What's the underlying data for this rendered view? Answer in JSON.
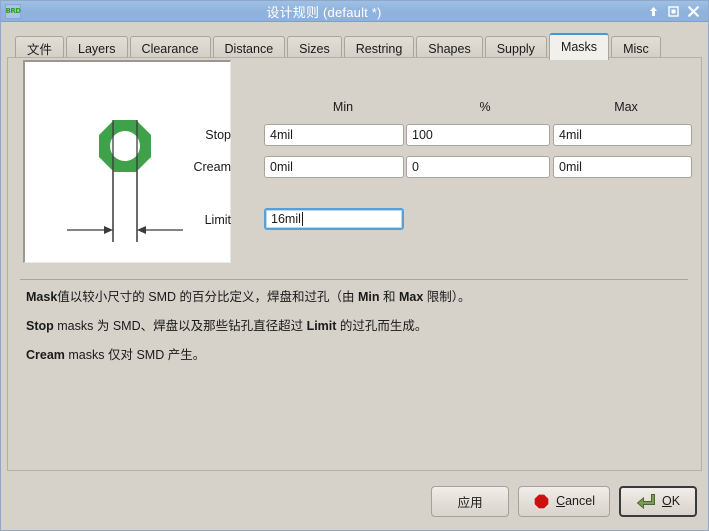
{
  "window": {
    "app_icon_label": "BRD",
    "title": "设计规则 (default *)",
    "controls": {
      "shade_label": "Shade",
      "maximize_label": "Maximize",
      "close_label": "Close"
    }
  },
  "tabs": [
    {
      "label": "文件",
      "active": false
    },
    {
      "label": "Layers",
      "active": false
    },
    {
      "label": "Clearance",
      "active": false
    },
    {
      "label": "Distance",
      "active": false
    },
    {
      "label": "Sizes",
      "active": false
    },
    {
      "label": "Restring",
      "active": false
    },
    {
      "label": "Shapes",
      "active": false
    },
    {
      "label": "Supply",
      "active": false
    },
    {
      "label": "Masks",
      "active": true
    },
    {
      "label": "Misc",
      "active": false
    }
  ],
  "masks": {
    "preview": {
      "pad_color": "#3ea24b",
      "hole_color": "#ffffff",
      "line_color": "#3b3b3b",
      "background": "#ffffff"
    },
    "columns": [
      "Min",
      "%",
      "Max"
    ],
    "rows": [
      {
        "label": "Stop",
        "min": "4mil",
        "percent": "100",
        "max": "4mil"
      },
      {
        "label": "Cream",
        "min": "0mil",
        "percent": "0",
        "max": "0mil"
      }
    ],
    "limit": {
      "label": "Limit",
      "value": "16mil",
      "focused": true
    },
    "description": [
      {
        "segments": [
          {
            "text": "Mask",
            "bold": true
          },
          {
            "text": "值以较小尺寸的 SMD 的百分比定义，焊盘和过孔（由 ",
            "bold": false
          },
          {
            "text": "Min",
            "bold": true
          },
          {
            "text": " 和 ",
            "bold": false
          },
          {
            "text": "Max",
            "bold": true
          },
          {
            "text": " 限制）。",
            "bold": false
          }
        ]
      },
      {
        "segments": [
          {
            "text": "Stop",
            "bold": true
          },
          {
            "text": " masks 为 SMD、焊盘以及那些钻孔直径超过 ",
            "bold": false
          },
          {
            "text": "Limit",
            "bold": true
          },
          {
            "text": " 的过孔而生成。",
            "bold": false
          }
        ]
      },
      {
        "segments": [
          {
            "text": "Cream",
            "bold": true
          },
          {
            "text": " masks 仅对 SMD 产生。",
            "bold": false
          }
        ]
      }
    ]
  },
  "footer": {
    "apply_label": "应用",
    "cancel_label": "Cancel",
    "cancel_mnemonic": "C",
    "ok_label": "OK",
    "ok_mnemonic": "O",
    "cancel_icon_color": "#cc1111",
    "ok_icon_color": "#7a9c55"
  }
}
